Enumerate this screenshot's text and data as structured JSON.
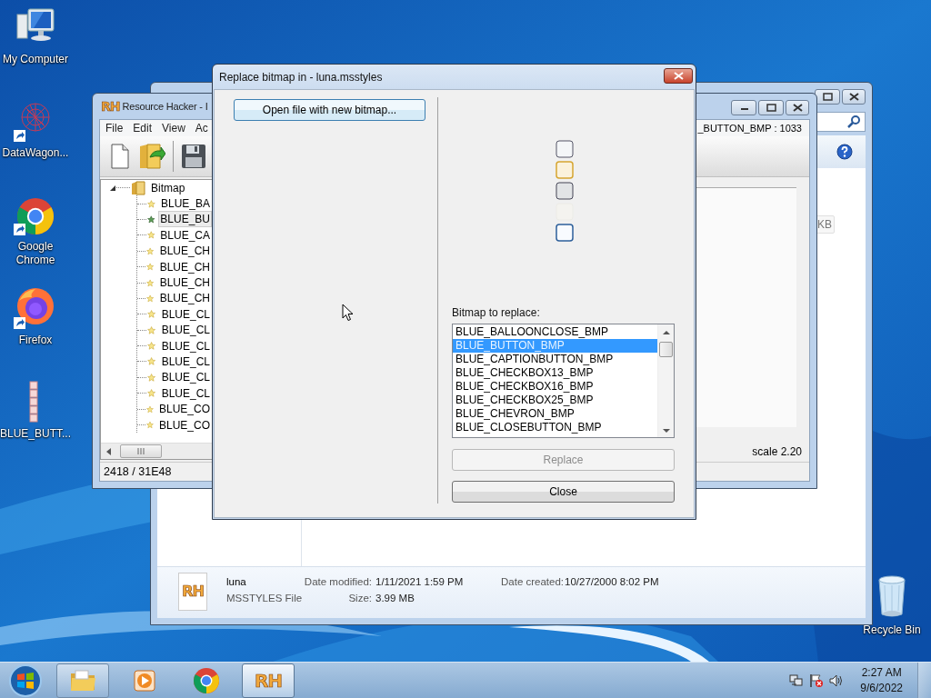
{
  "desktop_icons": [
    {
      "kind": "computer",
      "label": "My Computer",
      "shortcut": false
    },
    {
      "kind": "network-graph",
      "label": "DataWagon...",
      "shortcut": true
    },
    {
      "kind": "chrome",
      "label": "Google Chrome",
      "shortcut": true
    },
    {
      "kind": "firefox",
      "label": "Firefox",
      "shortcut": true
    },
    {
      "kind": "bitmap",
      "label": "BLUE_BUTT...",
      "shortcut": false
    }
  ],
  "recycle_bin": {
    "label": "Recycle Bin"
  },
  "explorer": {
    "size_text": "KB",
    "details": {
      "logo": "RH",
      "file_name": "luna",
      "file_type": "MSSTYLES File",
      "fields": [
        {
          "label": "Date modified:",
          "value": "1/11/2021 1:59 PM"
        },
        {
          "label": "Date created:",
          "value": "10/27/2000 8:02 PM"
        },
        {
          "label": "Size:",
          "value": "3.99 MB"
        }
      ]
    }
  },
  "resource_hacker": {
    "logo": "RH",
    "title": "Resource Hacker - I",
    "menu": [
      "File",
      "Edit",
      "View",
      "Ac"
    ],
    "resource_name": "_BUTTON_BMP : 1033",
    "tree": {
      "label": "Bitmap",
      "expanded": true,
      "children": [
        {
          "label": "BLUE_BA",
          "selected": false
        },
        {
          "label": "BLUE_BU",
          "selected": true
        },
        {
          "label": "BLUE_CA",
          "selected": false
        },
        {
          "label": "BLUE_CH",
          "selected": false
        },
        {
          "label": "BLUE_CH",
          "selected": false
        },
        {
          "label": "BLUE_CH",
          "selected": false
        },
        {
          "label": "BLUE_CH",
          "selected": false
        },
        {
          "label": "BLUE_CL",
          "selected": false
        },
        {
          "label": "BLUE_CL",
          "selected": false
        },
        {
          "label": "BLUE_CL",
          "selected": false
        },
        {
          "label": "BLUE_CL",
          "selected": false
        },
        {
          "label": "BLUE_CL",
          "selected": false
        },
        {
          "label": "BLUE_CL",
          "selected": false
        },
        {
          "label": "BLUE_CO",
          "selected": false
        },
        {
          "label": "BLUE_CO",
          "selected": false
        }
      ]
    },
    "scale": "scale 2.20",
    "status": "2418 / 31E48"
  },
  "dialog": {
    "title": "Replace bitmap in - luna.msstyles",
    "open_button": "Open file with new bitmap...",
    "list_label": "Bitmap to replace:",
    "list_items": [
      {
        "label": "BLUE_BALLOONCLOSE_BMP",
        "selected": false
      },
      {
        "label": "BLUE_BUTTON_BMP",
        "selected": true
      },
      {
        "label": "BLUE_CAPTIONBUTTON_BMP",
        "selected": false
      },
      {
        "label": "BLUE_CHECKBOX13_BMP",
        "selected": false
      },
      {
        "label": "BLUE_CHECKBOX16_BMP",
        "selected": false
      },
      {
        "label": "BLUE_CHECKBOX25_BMP",
        "selected": false
      },
      {
        "label": "BLUE_CHEVRON_BMP",
        "selected": false
      },
      {
        "label": "BLUE_CLOSEBUTTON_BMP",
        "selected": false
      }
    ],
    "buttons": [
      {
        "label": "Replace",
        "disabled": true
      },
      {
        "label": "Close",
        "disabled": false
      }
    ]
  },
  "taskbar": {
    "apps": [
      {
        "kind": "folder",
        "open": true,
        "active": false
      },
      {
        "kind": "media",
        "open": false,
        "active": false
      },
      {
        "kind": "chrome",
        "open": false,
        "active": false
      },
      {
        "kind": "rh",
        "label": "RH",
        "open": true,
        "active": true
      }
    ],
    "time": "2:27 AM",
    "date": "9/6/2022"
  }
}
